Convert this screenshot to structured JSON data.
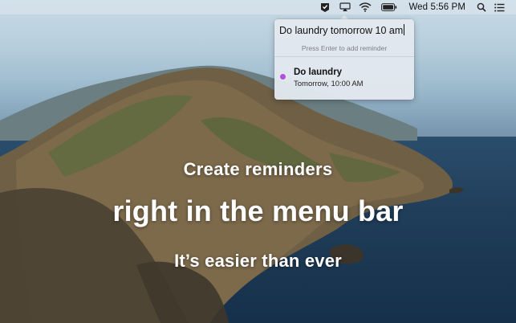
{
  "menubar": {
    "icons": [
      "reminders-check-icon",
      "airplay-icon",
      "wifi-icon",
      "battery-icon",
      "search-icon",
      "list-icon"
    ],
    "clock": "Wed 5:56 PM"
  },
  "popover": {
    "input_value": "Do laundry tomorrow 10 am",
    "hint": "Press Enter to add reminder",
    "reminder": {
      "title": "Do laundry",
      "time": "Tomorrow, 10:00 AM",
      "dot_color": "#b34fe0"
    }
  },
  "promo": {
    "line1": "Create reminders",
    "line2": "right in the menu bar",
    "line3": "It’s easier than ever"
  }
}
